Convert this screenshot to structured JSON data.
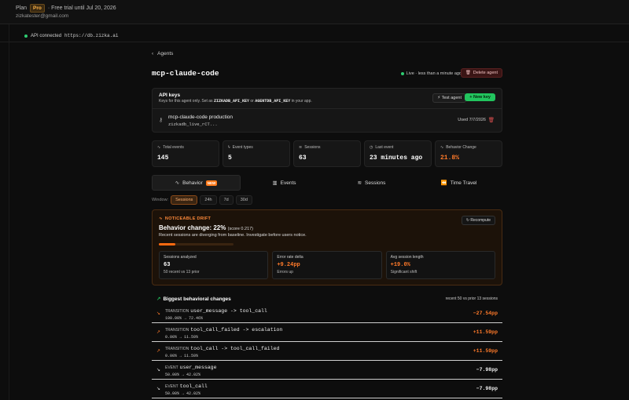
{
  "topbar": {
    "plan_label": "Plan",
    "plan_badge": "Pro",
    "trial_text": "· Free trial until Jul 20, 2026",
    "email": "zizkatester@gmail.com"
  },
  "api": {
    "status_text": "API connected",
    "url": "https://db.zizka.ai"
  },
  "breadcrumb": {
    "back_label": "Agents"
  },
  "agent": {
    "name": "mcp-claude-code",
    "live_text": "Live · less than a minute ago",
    "delete_label": "Delete agent"
  },
  "api_keys": {
    "title": "API keys",
    "desc_prefix": "Keys for this agent only. Set as",
    "env1": "ZIZKADB_API_KEY",
    "desc_or": "or",
    "env2": "AGENTDB_API_KEY",
    "desc_suffix": "in your app.",
    "test_label": "Test agent",
    "new_label": "+ New key",
    "key_name": "mcp-claude-code production",
    "key_value": "zizkadb_live_rCT...",
    "key_used": "Used 7/7/2026"
  },
  "stats": [
    {
      "label": "Total events",
      "value": "145",
      "icon": "activity-icon"
    },
    {
      "label": "Event types",
      "value": "5",
      "icon": "bolt-icon"
    },
    {
      "label": "Sessions",
      "value": "63",
      "icon": "layers-icon"
    },
    {
      "label": "Last event",
      "value": "23 minutes ago",
      "icon": "clock-icon"
    },
    {
      "label": "Behavior Change",
      "value": "21.8%",
      "icon": "pulse-icon"
    }
  ],
  "tabs": [
    {
      "label": "Behavior",
      "badge": "NEW"
    },
    {
      "label": "Events"
    },
    {
      "label": "Sessions"
    },
    {
      "label": "Time Travel"
    }
  ],
  "window": {
    "label": "Window:",
    "options": [
      "Sessions",
      "24h",
      "7d",
      "30d"
    ],
    "selected": "Sessions"
  },
  "drift": {
    "tag": "NOTICEABLE DRIFT",
    "headline": "Behavior change: 22%",
    "score": "(score 0.217)",
    "description": "Recent sessions are diverging from baseline. Investigate before users notice.",
    "progress": 0.22,
    "recompute_label": "Recompute",
    "boxes": [
      {
        "label": "Sessions analyzed",
        "value": "63",
        "sub": "50 recent vs 13 prior"
      },
      {
        "label": "Error rate delta",
        "value": "+9.24pp",
        "sub": "Errors up"
      },
      {
        "label": "Avg session length",
        "value": "+19.0%",
        "sub": "Significant shift"
      }
    ]
  },
  "changes": {
    "title": "Biggest behavioral changes",
    "subtitle": "recent 50 vs prior 13 sessions",
    "rows": [
      {
        "kind": "TRANSITION",
        "name": "user_message -> tool_call",
        "range": "100.00% → 72.46%",
        "delta": "−27.54pp"
      },
      {
        "kind": "TRANSITION",
        "name": "tool_call_failed -> escalation",
        "range": "0.00% → 11.59%",
        "delta": "+11.59pp"
      },
      {
        "kind": "TRANSITION",
        "name": "tool_call -> tool_call_failed",
        "range": "0.00% → 11.59%",
        "delta": "+11.59pp"
      },
      {
        "kind": "EVENT",
        "name": "user_message",
        "range": "50.00% → 42.02%",
        "delta": "−7.98pp"
      },
      {
        "kind": "EVENT",
        "name": "tool_call",
        "range": "50.00% → 42.02%",
        "delta": "−7.98pp"
      }
    ]
  },
  "colors": {
    "accent": "#ff7a2a",
    "success": "#22c55e",
    "danger": "#e05050"
  }
}
